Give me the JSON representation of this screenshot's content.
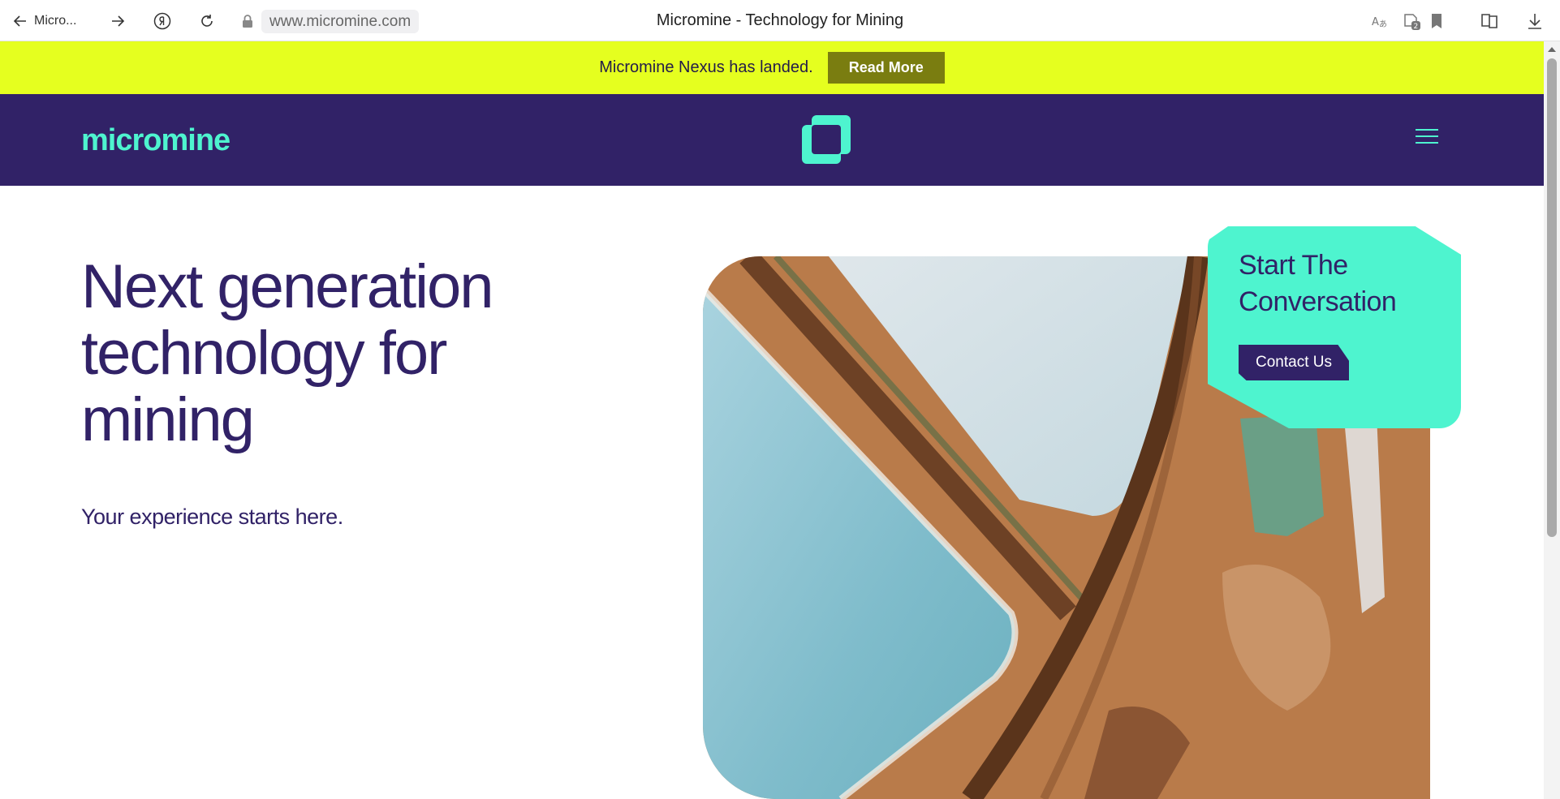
{
  "browser": {
    "back_label": "Micro...",
    "url": "www.micromine.com",
    "title": "Micromine - Technology for Mining",
    "tab_count": "2"
  },
  "announcement": {
    "text": "Micromine Nexus has landed.",
    "button": "Read More"
  },
  "header": {
    "logo_text": "micromine"
  },
  "hero": {
    "title": "Next generation technology for mining",
    "subtitle": "Your experience starts here."
  },
  "cta": {
    "title": "Start The Conversation",
    "button": "Contact Us"
  },
  "colors": {
    "brand_navy": "#312267",
    "brand_teal": "#4ef4cf",
    "announce_bg": "#e5ff1f",
    "announce_btn": "#7a7d10"
  }
}
